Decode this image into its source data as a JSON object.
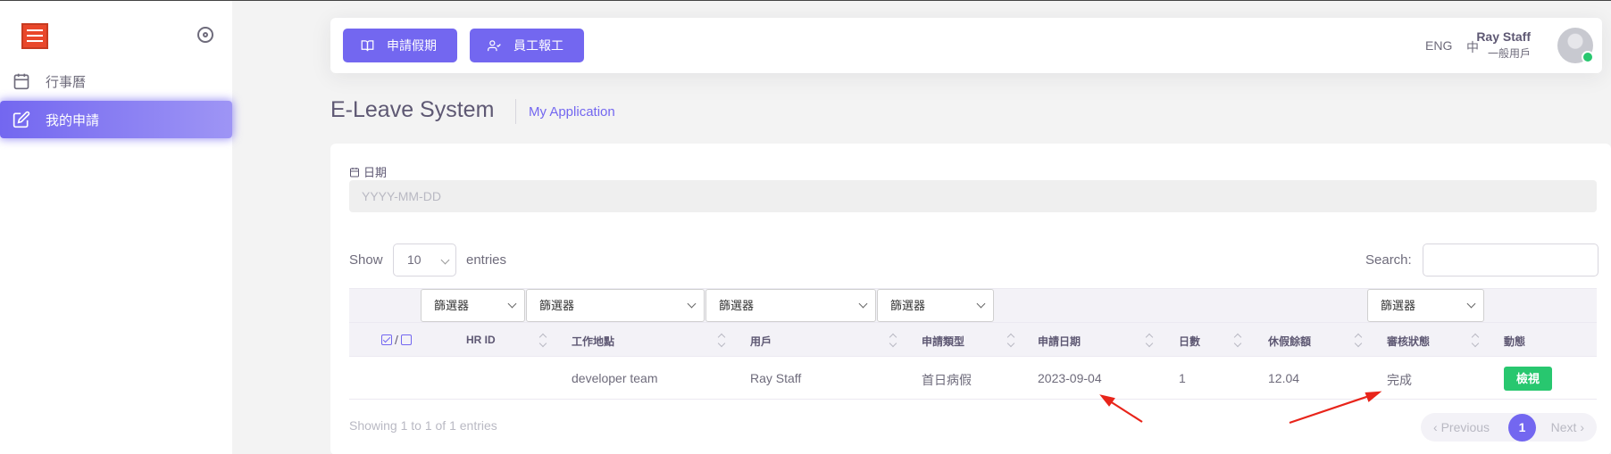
{
  "sidebar": {
    "items": [
      {
        "label": "行事曆",
        "icon": "calendar-icon"
      },
      {
        "label": "我的申請",
        "icon": "edit-icon"
      }
    ]
  },
  "topbar": {
    "apply_leave_label": "申請假期",
    "staff_report_label": "員工報工",
    "lang_en": "ENG",
    "lang_zh": "中",
    "user_name": "Ray Staff",
    "user_role": "一般用戶"
  },
  "page": {
    "title": "E-Leave System",
    "breadcrumb": "My Application"
  },
  "filter": {
    "date_label": "日期",
    "date_placeholder": "YYYY-MM-DD"
  },
  "table_controls": {
    "show_label": "Show",
    "page_length": "10",
    "entries_label": "entries",
    "search_label": "Search:"
  },
  "column_filters": [
    "篩選器",
    "篩選器",
    "篩選器",
    "篩選器",
    "篩選器"
  ],
  "table": {
    "check_separator": "/",
    "headers": [
      "HR ID",
      "工作地點",
      "用戶",
      "申請類型",
      "申請日期",
      "日數",
      "休假餘額",
      "審核狀態",
      "動態"
    ],
    "rows": [
      {
        "hr_id": "",
        "location": "developer team",
        "user": "Ray Staff",
        "type": "首日病假",
        "date": "2023-09-04",
        "days": "1",
        "balance": "12.04",
        "status": "完成",
        "action": "檢視"
      }
    ]
  },
  "footer": {
    "info": "Showing 1 to 1 of 1 entries",
    "prev": "Previous",
    "next": "Next",
    "current_page": "1"
  },
  "colors": {
    "primary": "#7367f0",
    "success": "#28c76f",
    "annotation": "#e8241a"
  }
}
